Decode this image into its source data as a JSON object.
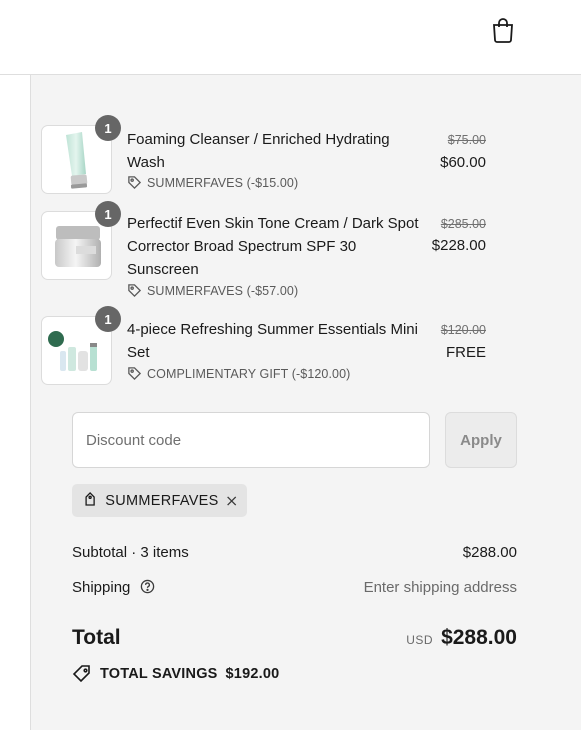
{
  "header": {
    "cart_icon": "shopping-bag-icon"
  },
  "items": [
    {
      "title": "Foaming Cleanser / Enriched Hydrating Wash",
      "quantity": "1",
      "discount_code": "SUMMERFAVES (-$15.00)",
      "price_original": "$75.00",
      "price_final": "$60.00"
    },
    {
      "title": "Perfectif Even Skin Tone Cream / Dark Spot Corrector Broad Spectrum SPF 30 Sunscreen",
      "quantity": "1",
      "discount_code": "SUMMERFAVES (-$57.00)",
      "price_original": "$285.00",
      "price_final": "$228.00"
    },
    {
      "title": "4-piece Refreshing Summer Essentials Mini Set",
      "quantity": "1",
      "discount_code": "COMPLIMENTARY GIFT (-$120.00)",
      "price_original": "$120.00",
      "price_final": "FREE"
    }
  ],
  "discount": {
    "placeholder": "Discount code",
    "apply_label": "Apply",
    "applied_code": "SUMMERFAVES"
  },
  "summary": {
    "subtotal_label": "Subtotal · 3 items",
    "subtotal_value": "$288.00",
    "shipping_label": "Shipping",
    "shipping_value": "Enter shipping address",
    "total_label": "Total",
    "currency": "USD",
    "total_value": "$288.00",
    "savings_label": "TOTAL SAVINGS",
    "savings_value": "$192.00"
  },
  "colors": {
    "panel_bg": "#f4f4f4",
    "badge_bg": "#666666",
    "border": "#dedede"
  }
}
